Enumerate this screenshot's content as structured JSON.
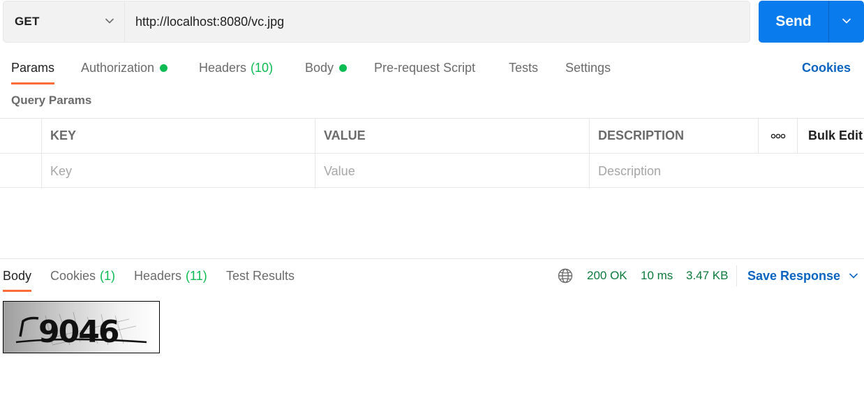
{
  "request": {
    "method": "GET",
    "url": "http://localhost:8080/vc.jpg",
    "send_label": "Send"
  },
  "request_tabs": [
    {
      "label": "Params",
      "active": true
    },
    {
      "label": "Authorization",
      "dot": true
    },
    {
      "label": "Headers",
      "count": "(10)"
    },
    {
      "label": "Body",
      "dot": true
    },
    {
      "label": "Pre-request Script"
    },
    {
      "label": "Tests"
    },
    {
      "label": "Settings"
    }
  ],
  "cookies_link": "Cookies",
  "query_params": {
    "title": "Query Params",
    "columns": [
      "KEY",
      "VALUE",
      "DESCRIPTION"
    ],
    "more_label": "ooo",
    "bulk_edit": "Bulk Edit",
    "placeholders": {
      "key": "Key",
      "value": "Value",
      "description": "Description"
    }
  },
  "response": {
    "tabs": [
      {
        "label": "Body",
        "active": true
      },
      {
        "label": "Cookies",
        "count": "(1)"
      },
      {
        "label": "Headers",
        "count": "(11)"
      },
      {
        "label": "Test Results"
      }
    ],
    "status": "200 OK",
    "time": "10 ms",
    "size": "3.47 KB",
    "save_label": "Save Response",
    "captcha_text": "9046"
  },
  "colors": {
    "accent_orange": "#ff6c37",
    "send_blue": "#097bed",
    "link_blue": "#0b64c0",
    "status_green": "#0c7a3d",
    "dot_green": "#0cbb52"
  }
}
